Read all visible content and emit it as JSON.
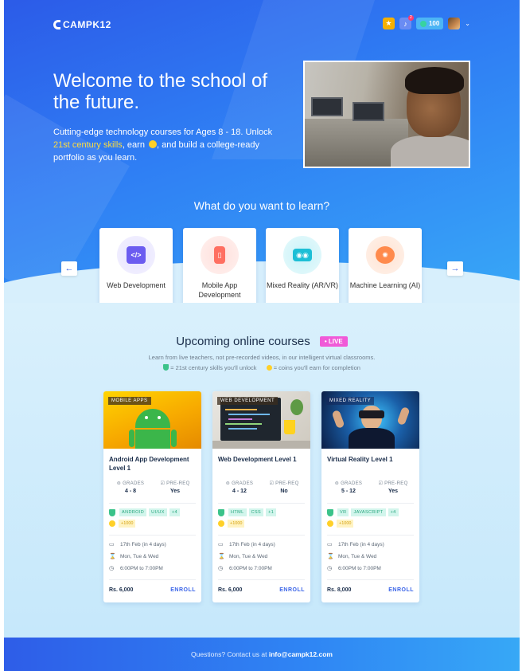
{
  "header": {
    "logo": "CAMPK12",
    "notification_count": "2",
    "coins": "100"
  },
  "hero": {
    "title": "Welcome to the school of the future.",
    "subtitle_part1": "Cutting-edge technology courses for Ages 8 - 18. Unlock ",
    "subtitle_highlight": "21st century skills",
    "subtitle_part2": ", earn ",
    "subtitle_part3": ", and build a college-ready portfolio as you learn."
  },
  "learn": {
    "title": "What do you want to learn?",
    "prev_arrow": "←",
    "next_arrow": "→",
    "categories": [
      {
        "label": "Web Development",
        "icon": "code-icon",
        "color": "#6b5cf0"
      },
      {
        "label": "Mobile App Development",
        "icon": "mobile-icon",
        "color": "#ff6f61"
      },
      {
        "label": "Mixed Reality (AR/VR)",
        "icon": "vr-headset-icon",
        "color": "#1dbfd6"
      },
      {
        "label": "Machine Learning (AI)",
        "icon": "brain-icon",
        "color": "#ff8a4c"
      }
    ]
  },
  "upcoming": {
    "title": "Upcoming online courses",
    "live_badge": "• LIVE",
    "subtitle": "Learn from live teachers, not pre-recorded videos, in our intelligent virtual classrooms.",
    "legend_skills": "= 21st century skills you'll unlock",
    "legend_coins": "= coins you'll earn for completion",
    "grades_label": "GRADES",
    "prereq_label": "PRE-REQ",
    "enroll_label": "ENROLL",
    "courses": [
      {
        "tag": "MOBILE APPS",
        "title": "Android App Development Level 1",
        "grades": "4 - 8",
        "prereq": "Yes",
        "skills": [
          "ANDROID",
          "UI/UX",
          "+4"
        ],
        "coins": "+1000",
        "date": "17th Feb (in 4 days)",
        "days": "Mon, Tue & Wed",
        "time": "6:00PM to 7:00PM",
        "price": "Rs. 6,000"
      },
      {
        "tag": "WEB DEVELOPMENT",
        "title": "Web Development Level 1",
        "grades": "4 - 12",
        "prereq": "No",
        "skills": [
          "HTML",
          "CSS",
          "+1"
        ],
        "coins": "+1000",
        "date": "17th Feb (in 4 days)",
        "days": "Mon, Tue & Wed",
        "time": "6:00PM to 7:00PM",
        "price": "Rs. 6,000"
      },
      {
        "tag": "MIXED REALITY",
        "title": "Virtual Reality Level 1",
        "grades": "5 - 12",
        "prereq": "Yes",
        "skills": [
          "VR",
          "JAVASCRIPT",
          "+4"
        ],
        "coins": "+1000",
        "date": "17th Feb (in 4 days)",
        "days": "Mon, Tue & Wed",
        "time": "6:00PM to 7:00PM",
        "price": "Rs. 8,000"
      }
    ]
  },
  "footer": {
    "text": "Questions? Contact us at ",
    "email": "info@campk12.com"
  }
}
